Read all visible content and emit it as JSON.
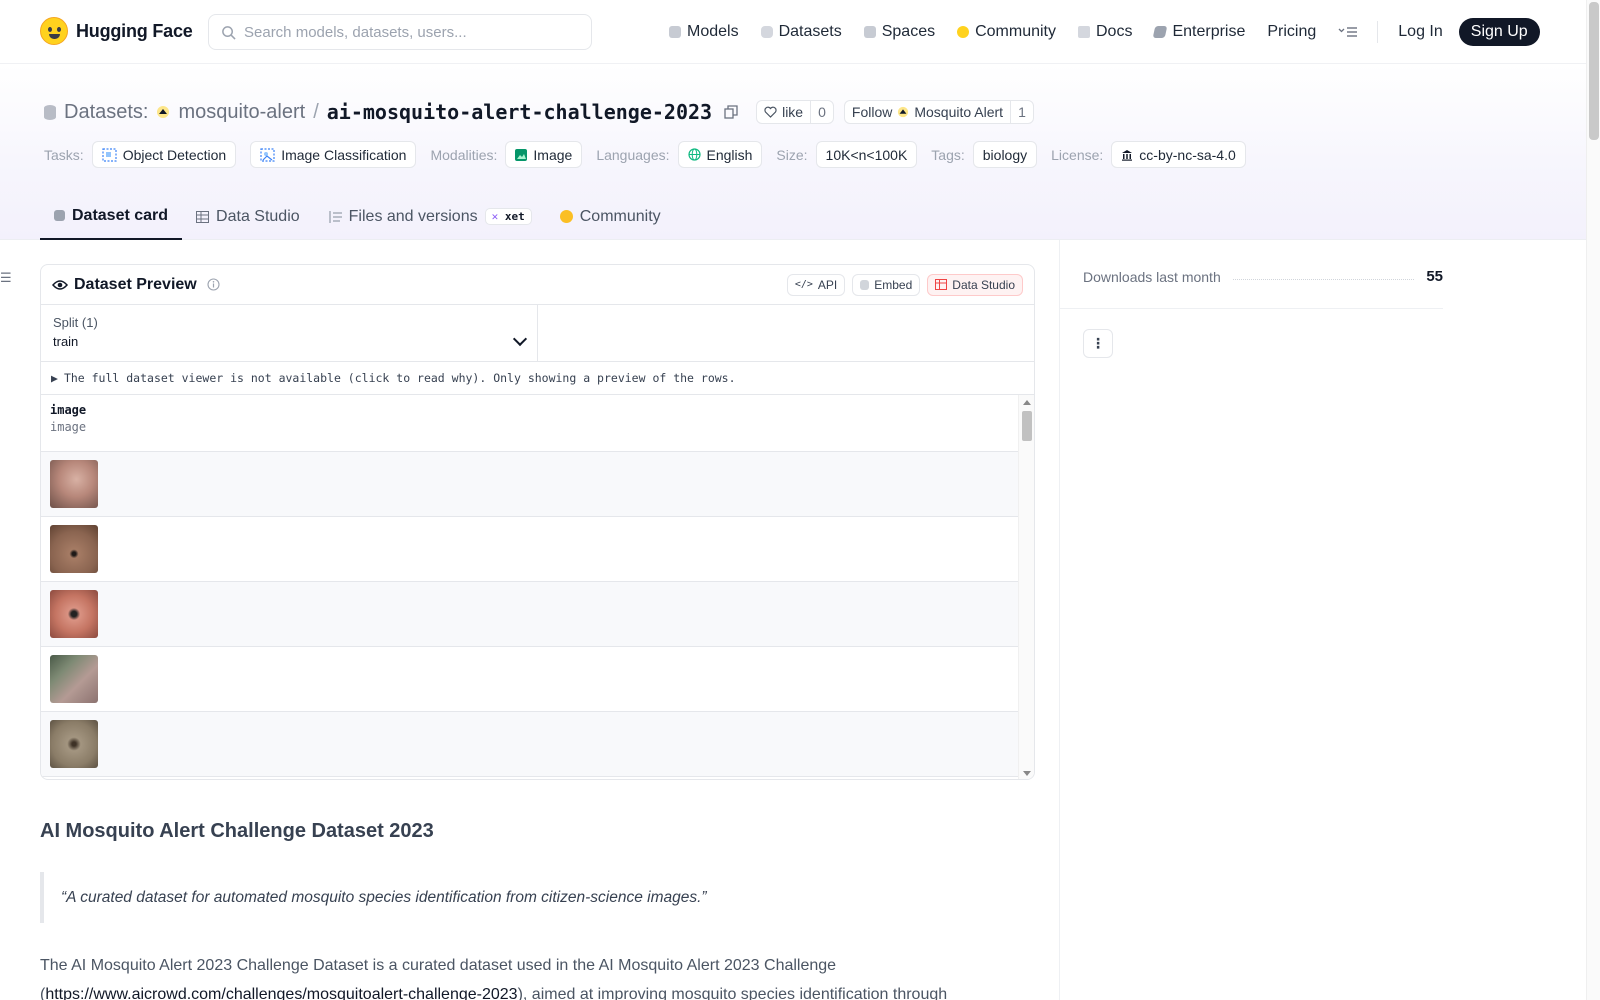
{
  "header": {
    "brand": "Hugging Face",
    "search_placeholder": "Search models, datasets, users...",
    "nav": [
      "Models",
      "Datasets",
      "Spaces",
      "Community",
      "Docs",
      "Enterprise",
      "Pricing"
    ],
    "login": "Log In",
    "signup": "Sign Up"
  },
  "repo": {
    "type_label": "Datasets:",
    "owner": "mosquito-alert",
    "separator": "/",
    "name": "ai-mosquito-alert-challenge-2023",
    "like_label": "like",
    "like_count": "0",
    "follow_label": "Follow",
    "follow_org": "Mosquito Alert",
    "follow_count": "1"
  },
  "tags": {
    "tasks_label": "Tasks:",
    "tasks": [
      "Object Detection",
      "Image Classification"
    ],
    "modalities_label": "Modalities:",
    "modality": "Image",
    "languages_label": "Languages:",
    "language": "English",
    "size_label": "Size:",
    "size": "10K<n<100K",
    "tags_label": "Tags:",
    "tag": "biology",
    "license_label": "License:",
    "license": "cc-by-nc-sa-4.0"
  },
  "tabs": {
    "dataset_card": "Dataset card",
    "data_studio": "Data Studio",
    "files": "Files and versions",
    "xet": "xet",
    "community": "Community"
  },
  "preview": {
    "title": "Dataset Preview",
    "api": "API",
    "embed": "Embed",
    "data_studio": "Data Studio",
    "split_label": "Split (1)",
    "split_value": "train",
    "notice": "The full dataset viewer is not available (click to read why). Only showing a preview of the rows.",
    "column_name": "image",
    "column_type": "image",
    "rows": 5
  },
  "card": {
    "heading": "AI Mosquito Alert Challenge Dataset 2023",
    "quote": "“A curated dataset for automated mosquito species identification from citizen-science images.”",
    "para_start": "The AI Mosquito Alert 2023 Challenge Dataset is a curated dataset used in the AI Mosquito Alert 2023 Challenge",
    "para_link": "https://www.aicrowd.com/challenges/mosquitoalert-challenge-2023",
    "para_end": "), aimed at improving mosquito species identification through"
  },
  "sidebar": {
    "downloads_label": "Downloads last month",
    "downloads_value": "55"
  },
  "colors": {
    "brand_yellow": "#ffd21e",
    "signup_bg": "#111827",
    "band_tint": "#f3f1fc"
  }
}
